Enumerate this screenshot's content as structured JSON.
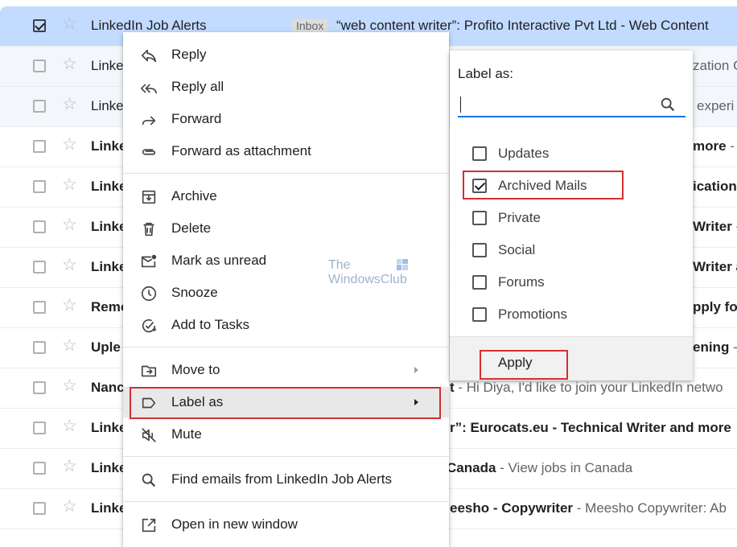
{
  "emails": [
    {
      "sender": "LinkedIn Job Alerts",
      "badge": "Inbox",
      "subject": "“web content writer”: Profito Interactive Pvt Ltd - Web Content",
      "selected": true
    },
    {
      "sender": "Linke",
      "right_bold": "",
      "right_gray": "zation C"
    },
    {
      "sender": "Linke",
      "right_bold": "",
      "right_gray": "experi"
    },
    {
      "sender": "Linke",
      "right_bold": "more",
      "right_gray": " - S"
    },
    {
      "sender": "Linke",
      "right_bold": "ication",
      "right_gray": ""
    },
    {
      "sender": "Linke",
      "right_bold": "Writer",
      "right_gray": " -"
    },
    {
      "sender": "Linke",
      "right_bold": "Writer a",
      "right_gray": ""
    },
    {
      "sender": "Remo",
      "right_bold": "pply fo",
      "right_gray": ""
    },
    {
      "sender": "Uple",
      "right_bold": "ening",
      "right_gray": " -"
    },
    {
      "sender": "Nanc",
      "right_bold": "t",
      "right_gray": " - Hi Diya, I'd like to join your LinkedIn netwo"
    },
    {
      "sender": "Linke",
      "right_bold": "r”: Eurocats.eu - Technical Writer and more",
      "right_gray": ""
    },
    {
      "sender": "Linke",
      "right_bold": "Canada",
      "right_gray": " - View jobs in Canada"
    },
    {
      "sender": "Linke",
      "right_bold": "eesho - Copywriter",
      "right_gray": " - Meesho Copywriter: Ab"
    }
  ],
  "context_menu": {
    "reply": "Reply",
    "reply_all": "Reply all",
    "forward": "Forward",
    "forward_attachment": "Forward as attachment",
    "archive": "Archive",
    "delete": "Delete",
    "mark_unread": "Mark as unread",
    "snooze": "Snooze",
    "add_tasks": "Add to Tasks",
    "move_to": "Move to",
    "label_as": "Label as",
    "mute": "Mute",
    "find_emails": "Find emails from LinkedIn Job Alerts",
    "open_window": "Open in new window"
  },
  "label_panel": {
    "title": "Label as:",
    "search_value": "",
    "labels": [
      {
        "name": "Updates",
        "checked": false
      },
      {
        "name": "Archived Mails",
        "checked": true
      },
      {
        "name": "Private",
        "checked": false
      },
      {
        "name": "Social",
        "checked": false
      },
      {
        "name": "Forums",
        "checked": false
      },
      {
        "name": "Promotions",
        "checked": false
      }
    ],
    "apply": "Apply"
  },
  "watermark": {
    "line1": "The",
    "line2": "WindowsClub"
  },
  "colors": {
    "highlight_red": "#d32f2f",
    "accent_blue": "#1a73e8",
    "selected_row": "#c2dbff"
  }
}
